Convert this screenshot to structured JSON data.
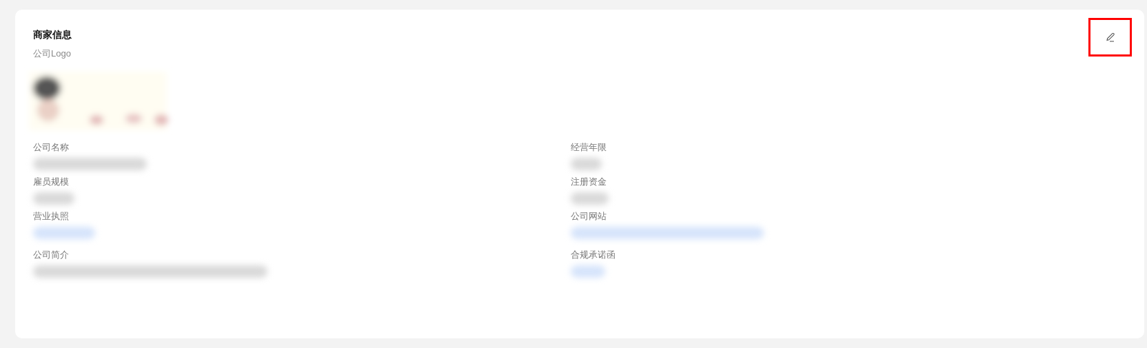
{
  "card": {
    "title": "商家信息",
    "edit_button": {
      "highlighted": true
    },
    "logo": {
      "label": "公司Logo"
    },
    "fields": [
      {
        "label": "公司名称",
        "kind": "text"
      },
      {
        "label": "经营年限",
        "kind": "text"
      },
      {
        "label": "雇员规模",
        "kind": "text"
      },
      {
        "label": "注册资金",
        "kind": "text"
      },
      {
        "label": "营业执照",
        "kind": "link"
      },
      {
        "label": "公司网站",
        "kind": "link"
      },
      {
        "label": "公司简介",
        "kind": "text"
      },
      {
        "label": "合规承诺函",
        "kind": "link"
      }
    ]
  }
}
